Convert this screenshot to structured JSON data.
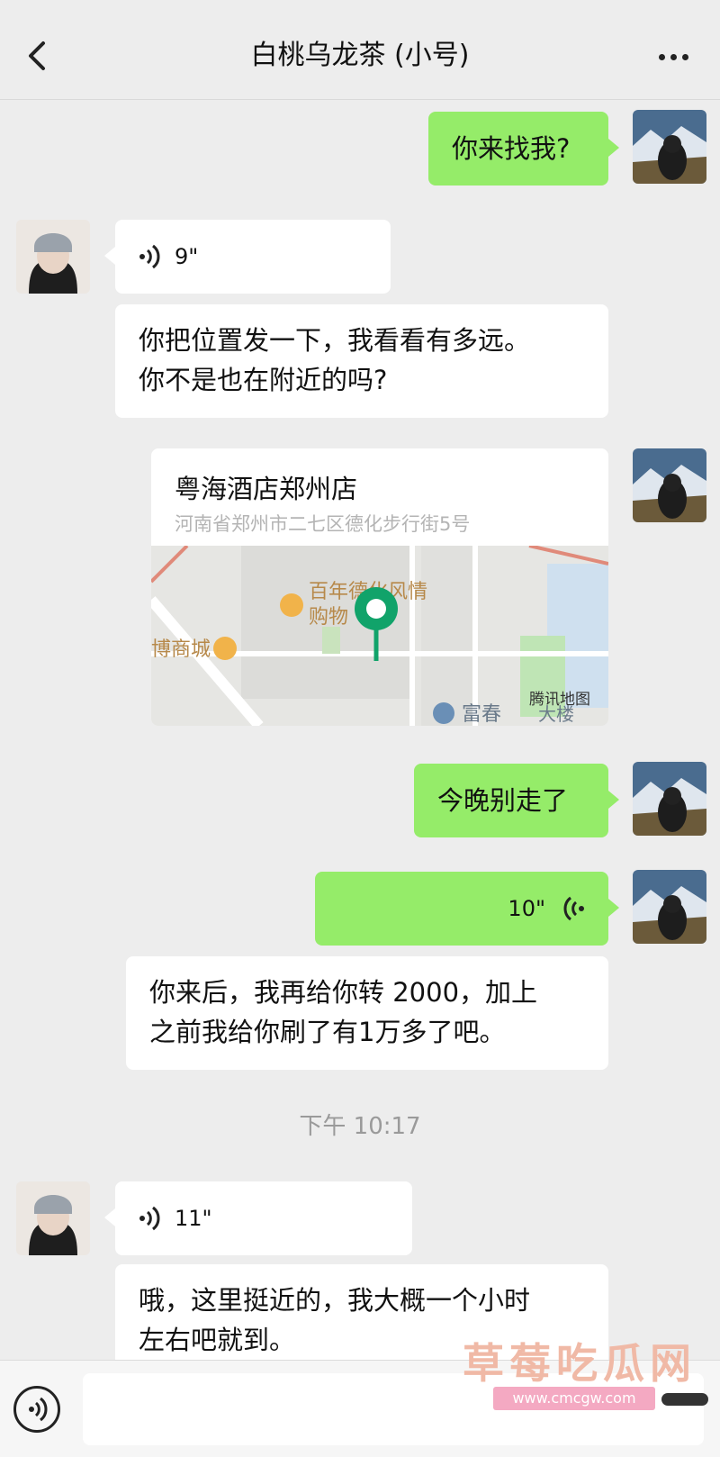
{
  "header": {
    "title": "白桃乌龙茶 (小号)",
    "back_icon": "chevron-left-icon",
    "more_icon": "more-dots-icon"
  },
  "messages": [
    {
      "side": "me",
      "type": "text",
      "text": "你来找我?"
    },
    {
      "side": "her",
      "type": "voice",
      "duration": "9\""
    },
    {
      "side": "her",
      "type": "text",
      "lines": [
        "你把位置发一下，我看看有多远。",
        "你不是也在附近的吗?"
      ]
    },
    {
      "side": "me",
      "type": "location",
      "name": "粤海酒店郑州店",
      "address": "河南省郑州市二七区德化步行街5号",
      "map_labels": {
        "poi1": "百年德化风情",
        "poi2": "购物",
        "poi3": "博商城",
        "poi4": "富春",
        "poi5": "大楼",
        "provider": "腾讯地图"
      }
    },
    {
      "side": "me",
      "type": "text",
      "text": "今晚别走了"
    },
    {
      "side": "me",
      "type": "voice",
      "duration": "10\""
    },
    {
      "side": "her",
      "type": "text",
      "lines": [
        "你来后，我再给你转 2000，加上",
        "之前我给你刷了有1万多了吧。"
      ]
    },
    {
      "side": "system",
      "type": "time",
      "text": "下午 10:17"
    },
    {
      "side": "her",
      "type": "voice",
      "duration": "11\""
    },
    {
      "side": "her",
      "type": "text",
      "lines": [
        "哦，这里挺近的，我大概一个小时",
        "左右吧就到。"
      ]
    }
  ],
  "watermark": {
    "text": "草莓吃瓜网",
    "url": "www.cmcgw.com"
  },
  "input": {
    "voice_icon": "voice-input-icon",
    "placeholder": ""
  },
  "colors": {
    "me_bubble": "#95ec69",
    "her_bubble": "#ffffff",
    "background": "#ededed",
    "map_pin": "#11a36a"
  }
}
